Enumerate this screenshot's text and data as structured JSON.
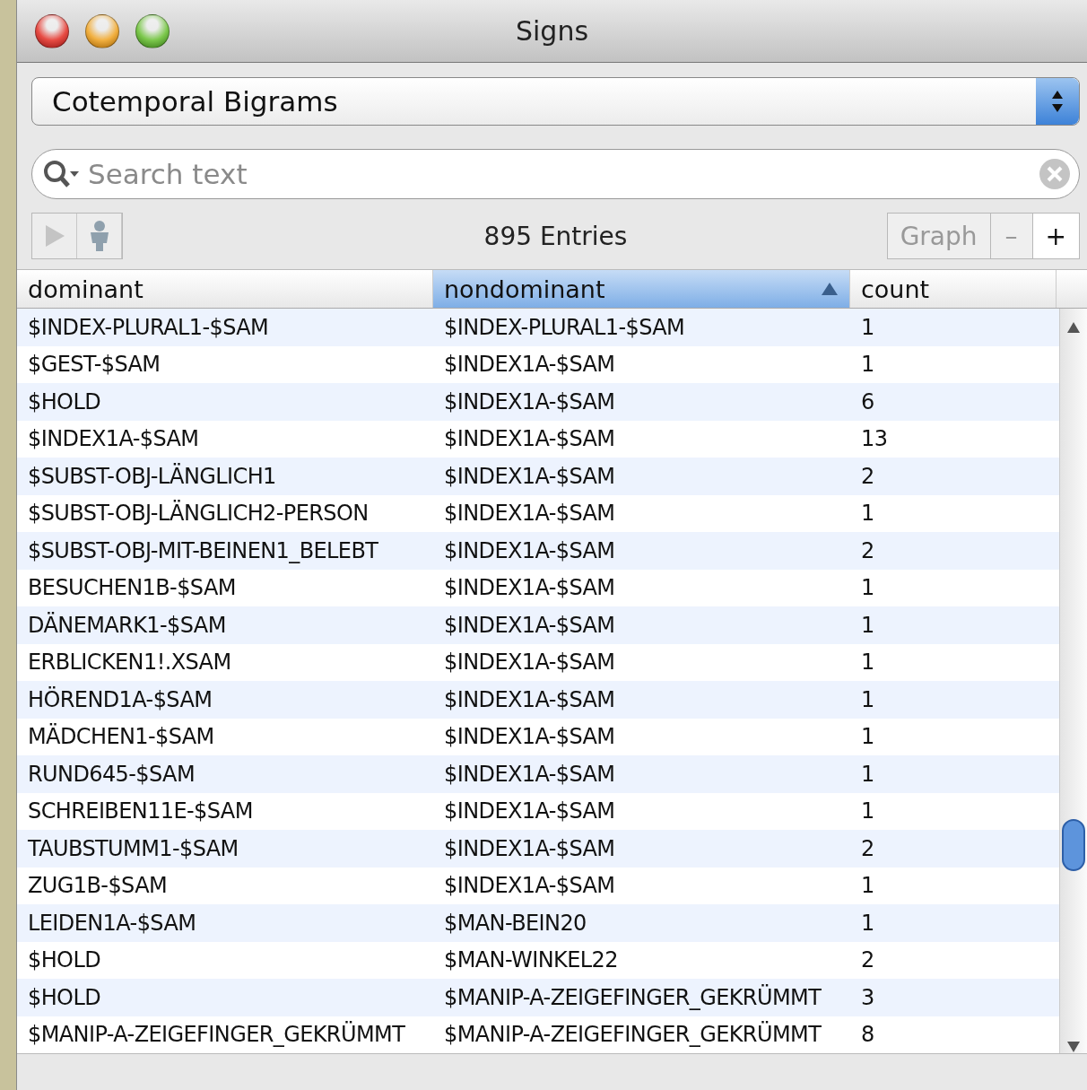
{
  "window": {
    "title": "Signs"
  },
  "view_select": {
    "value": "Cotemporal Bigrams"
  },
  "search": {
    "placeholder": "Search text"
  },
  "toolbar": {
    "entries": "895 Entries",
    "buttons": [
      {
        "label": "Graph",
        "disabled": true
      },
      {
        "label": "–",
        "disabled": true
      },
      {
        "label": "+",
        "disabled": false
      }
    ]
  },
  "table": {
    "columns": [
      {
        "label": "dominant",
        "selected": false,
        "sorted": false
      },
      {
        "label": "nondominant",
        "selected": true,
        "sorted": true
      },
      {
        "label": "count",
        "selected": false,
        "sorted": false
      }
    ],
    "rows": [
      [
        "$INDEX-PLURAL1-$SAM",
        "$INDEX-PLURAL1-$SAM",
        "1"
      ],
      [
        "$GEST-$SAM",
        "$INDEX1A-$SAM",
        "1"
      ],
      [
        "$HOLD",
        "$INDEX1A-$SAM",
        "6"
      ],
      [
        "$INDEX1A-$SAM",
        "$INDEX1A-$SAM",
        "13"
      ],
      [
        "$SUBST-OBJ-LÄNGLICH1",
        "$INDEX1A-$SAM",
        "2"
      ],
      [
        "$SUBST-OBJ-LÄNGLICH2-PERSON",
        "$INDEX1A-$SAM",
        "1"
      ],
      [
        "$SUBST-OBJ-MIT-BEINEN1_BELEBT",
        "$INDEX1A-$SAM",
        "2"
      ],
      [
        "BESUCHEN1B-$SAM",
        "$INDEX1A-$SAM",
        "1"
      ],
      [
        "DÄNEMARK1-$SAM",
        "$INDEX1A-$SAM",
        "1"
      ],
      [
        "ERBLICKEN1!.XSAM",
        "$INDEX1A-$SAM",
        "1"
      ],
      [
        "HÖREND1A-$SAM",
        "$INDEX1A-$SAM",
        "1"
      ],
      [
        "MÄDCHEN1-$SAM",
        "$INDEX1A-$SAM",
        "1"
      ],
      [
        "RUND645-$SAM",
        "$INDEX1A-$SAM",
        "1"
      ],
      [
        "SCHREIBEN11E-$SAM",
        "$INDEX1A-$SAM",
        "1"
      ],
      [
        "TAUBSTUMM1-$SAM",
        "$INDEX1A-$SAM",
        "2"
      ],
      [
        "ZUG1B-$SAM",
        "$INDEX1A-$SAM",
        "1"
      ],
      [
        "LEIDEN1A-$SAM",
        "$MAN-BEIN20",
        "1"
      ],
      [
        "$HOLD",
        "$MAN-WINKEL22",
        "2"
      ],
      [
        "$HOLD",
        "$MANIP-A-ZEIGEFINGER_GEKRÜMMT",
        "3"
      ],
      [
        "$MANIP-A-ZEIGEFINGER_GEKRÜMMT",
        "$MANIP-A-ZEIGEFINGER_GEKRÜMMT",
        "8"
      ]
    ]
  }
}
